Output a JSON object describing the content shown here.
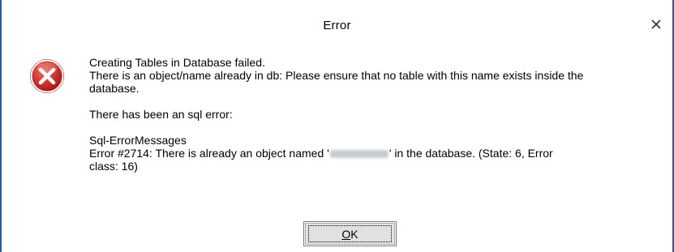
{
  "window": {
    "title": "Error",
    "close_icon": "close-icon"
  },
  "icon": {
    "name": "error-icon",
    "color": "#d0312d"
  },
  "message": {
    "line1": "Creating Tables in Database failed.",
    "line2": "There is an object/name already in db: Please ensure that no table with this name exists inside the",
    "line3": "database.",
    "line4": "There has been an sql error:",
    "line5": "Sql-ErrorMessages",
    "line6_before": "Error #2714: There is already an object named '",
    "line6_after": "' in the database. (State: 6, Error",
    "line7": "class: 16)"
  },
  "buttons": {
    "ok_mnemonic": "O",
    "ok_rest": "K"
  },
  "colors": {
    "border": "#1f5fa8",
    "button_bg": "#e1e1e1"
  }
}
